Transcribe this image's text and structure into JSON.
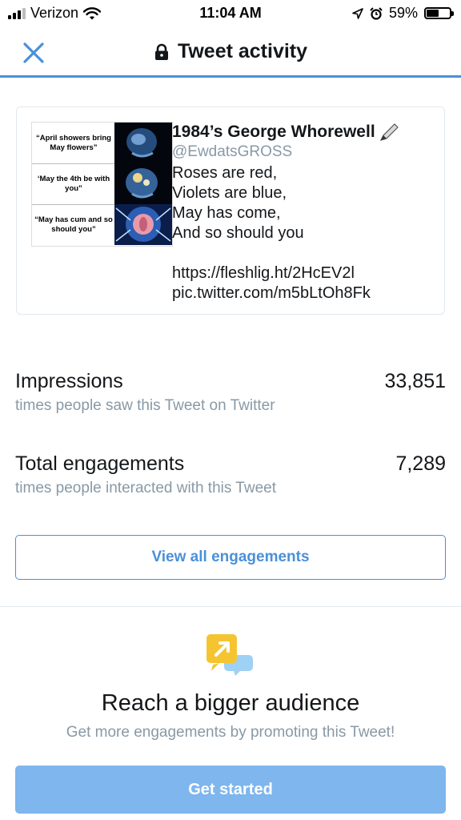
{
  "status_bar": {
    "carrier": "Verizon",
    "time": "11:04 AM",
    "battery_percent": "59%",
    "battery_level": 0.59,
    "icons": [
      "signal-icon",
      "wifi-icon",
      "location-icon",
      "alarm-icon",
      "battery-icon"
    ]
  },
  "nav": {
    "title": "Tweet activity",
    "close_icon": "close-icon",
    "title_icon": "lock-icon"
  },
  "tweet": {
    "author": "1984’s George Whorewell",
    "author_emoji_icon": "pen-icon",
    "handle": "@EwdatsGROSS",
    "text": "Roses are red,\nViolets are blue,\nMay has come,\nAnd so should you\n\nhttps://fleshlig.ht/2HcEV2l\npic.twitter.com/m5bLtOh8Fk",
    "meme_panels": [
      {
        "caption": "“April showers bring May flowers”"
      },
      {
        "caption": "‘May the 4th be with you”"
      },
      {
        "caption": "“May has cum and so should you”"
      }
    ]
  },
  "stats": {
    "impressions": {
      "label": "Impressions",
      "value": "33,851",
      "description": "times people saw this Tweet on Twitter"
    },
    "engagements": {
      "label": "Total engagements",
      "value": "7,289",
      "description": "times people interacted with this Tweet"
    }
  },
  "actions": {
    "view_all": "View all engagements"
  },
  "promo": {
    "icon": "promote-icon",
    "title": "Reach a bigger audience",
    "subtitle": "Get more engagements by promoting this Tweet!",
    "cta": "Get started"
  },
  "colors": {
    "accent": "#4a90d9",
    "cta_bg": "#7eb6ed",
    "muted_text": "#8899a6",
    "border": "#e1e8ed",
    "promo_yellow": "#f5c531",
    "promo_blue": "#9fd1f5"
  }
}
